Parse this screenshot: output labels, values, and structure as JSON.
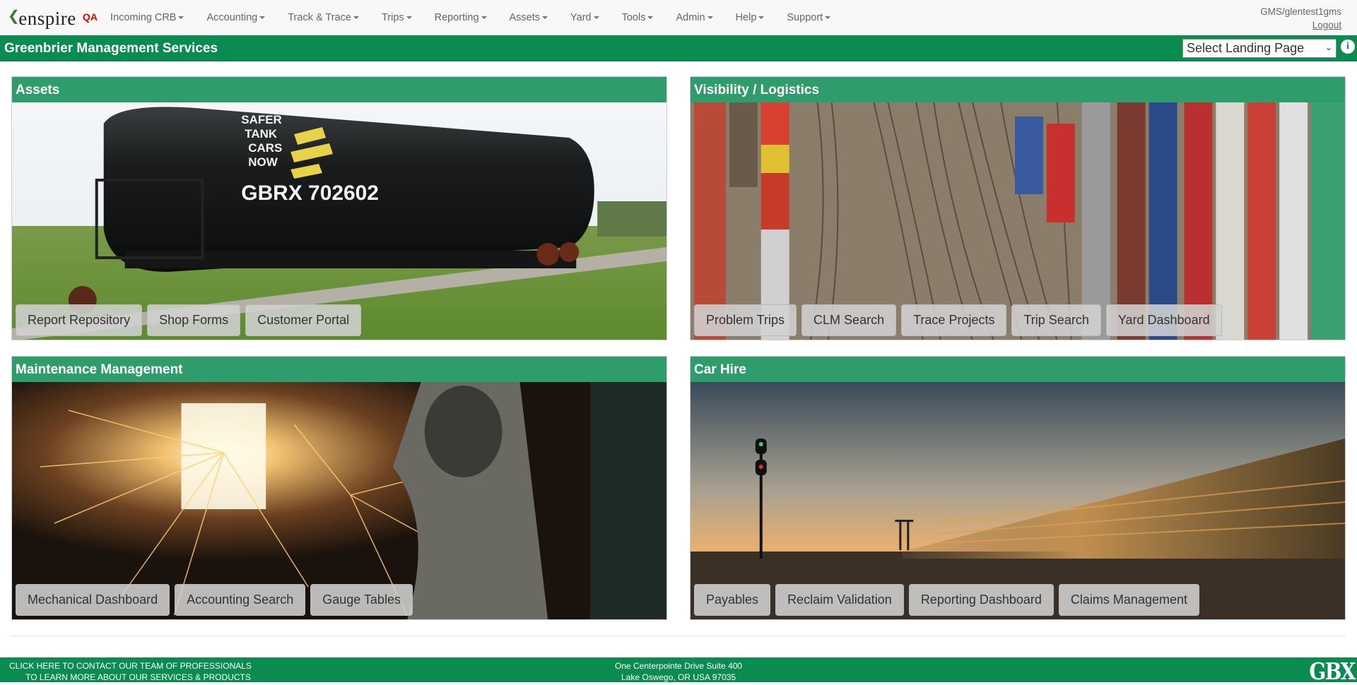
{
  "brand": {
    "logo_text": "enspire",
    "env": "QA"
  },
  "menu": [
    {
      "label": "Incoming CRB"
    },
    {
      "label": "Accounting"
    },
    {
      "label": "Track & Trace"
    },
    {
      "label": "Trips"
    },
    {
      "label": "Reporting"
    },
    {
      "label": "Assets"
    },
    {
      "label": "Yard"
    },
    {
      "label": "Tools"
    },
    {
      "label": "Admin"
    },
    {
      "label": "Help"
    },
    {
      "label": "Support"
    }
  ],
  "user": {
    "name": "GMS/glentest1gms",
    "logout": "Logout"
  },
  "titlebar": {
    "company": "Greenbrier Management Services",
    "landing_select": "Select Landing Page"
  },
  "tiles": {
    "assets": {
      "title": "Assets",
      "buttons": [
        "Report Repository",
        "Shop Forms",
        "Customer Portal"
      ],
      "car_lines": [
        "SAFER",
        "TANK",
        "CARS",
        "NOW"
      ],
      "car_id": "GBRX 702602"
    },
    "visibility": {
      "title": "Visibility / Logistics",
      "buttons": [
        "Problem Trips",
        "CLM Search",
        "Trace Projects",
        "Trip Search",
        "Yard Dashboard"
      ]
    },
    "maintenance": {
      "title": "Maintenance Management",
      "buttons": [
        "Mechanical Dashboard",
        "Accounting Search",
        "Gauge Tables"
      ]
    },
    "carhire": {
      "title": "Car Hire",
      "buttons": [
        "Payables",
        "Reclaim Validation",
        "Reporting Dashboard",
        "Claims Management"
      ]
    }
  },
  "footer": {
    "contact_line1": "CLICK HERE TO CONTACT OUR TEAM OF PROFESSIONALS",
    "contact_line2": "TO LEARN MORE ABOUT OUR SERVICES & PRODUCTS",
    "address_line1": "One Centerpointe Drive Suite 400",
    "address_line2": "Lake Oswego, OR USA 97035",
    "logo": "GBX"
  },
  "colors": {
    "brand_green": "#0a8c51",
    "env_red": "#e00000"
  }
}
